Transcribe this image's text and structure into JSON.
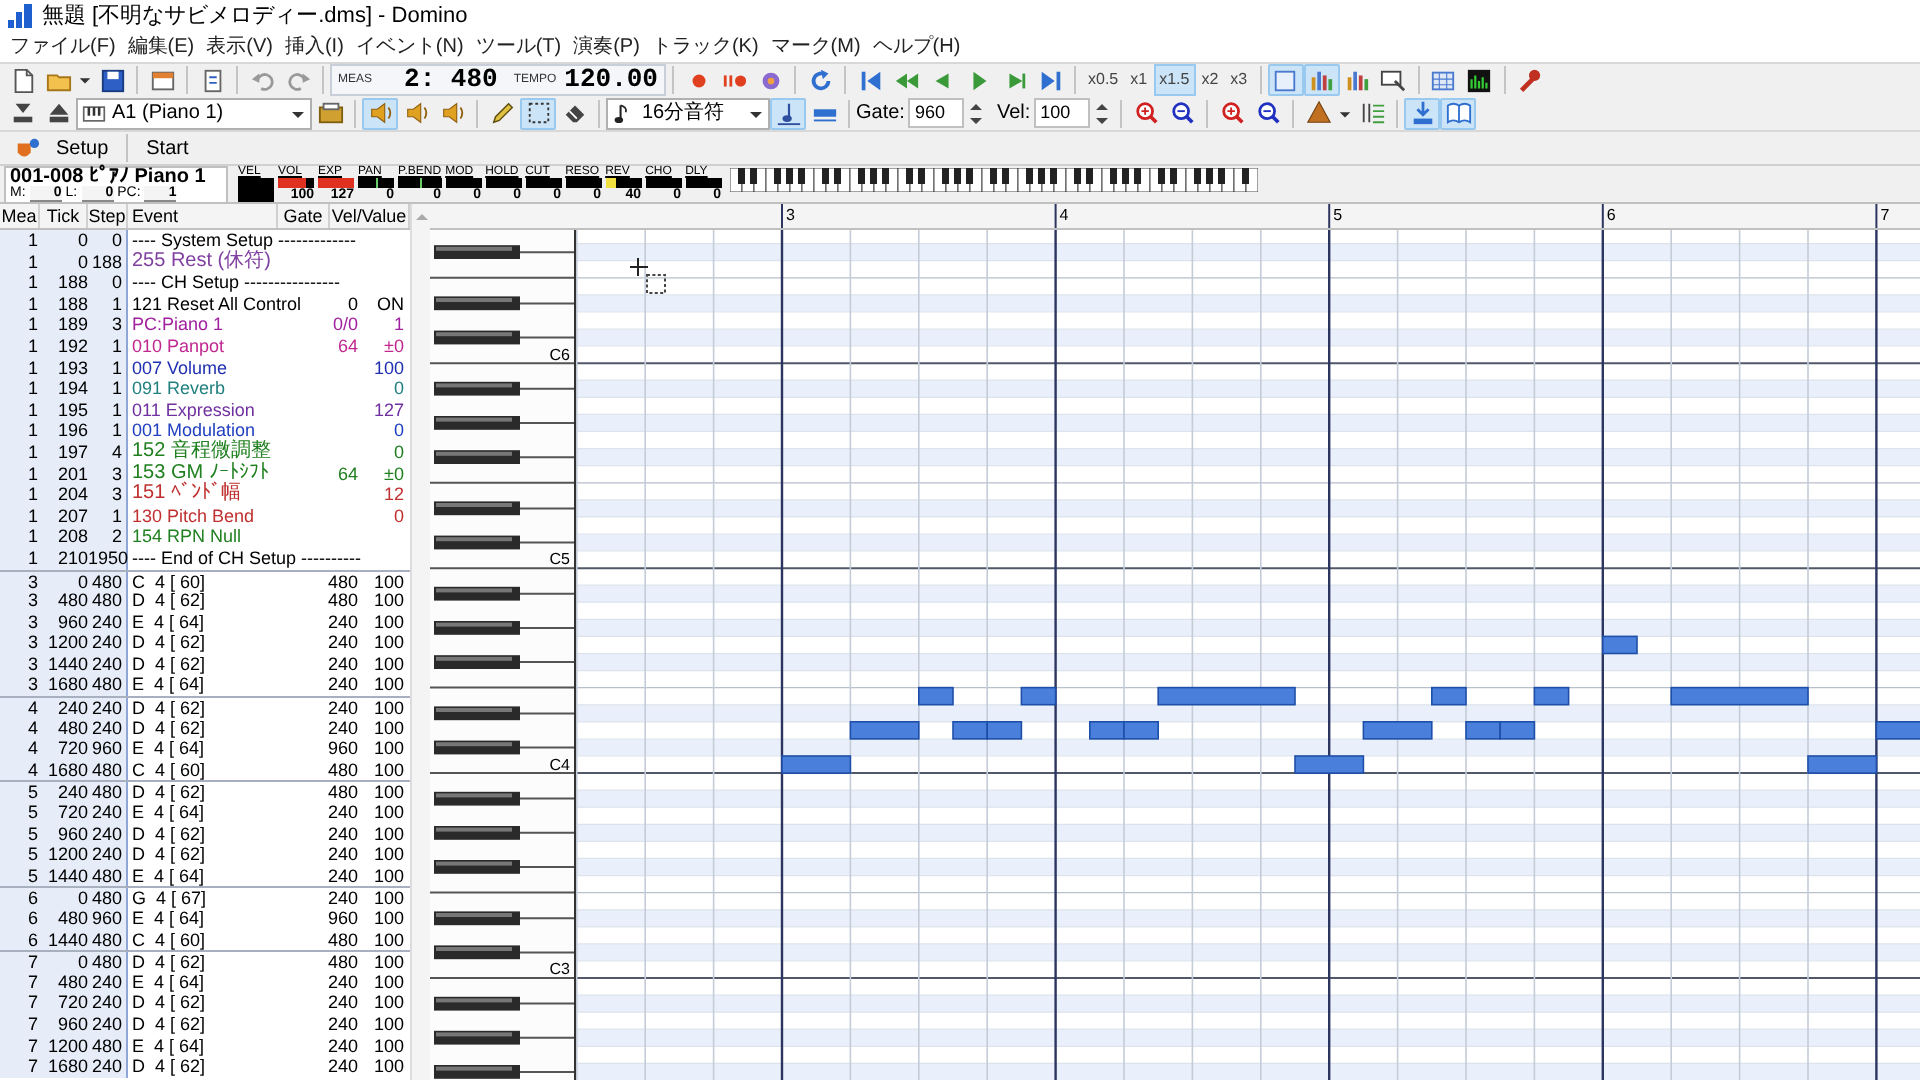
{
  "window": {
    "title": "無題 [不明なサビメロディー.dms] - Domino"
  },
  "menu": [
    "ファイル(F)",
    "編集(E)",
    "表示(V)",
    "挿入(I)",
    "イベント(N)",
    "ツール(T)",
    "演奏(P)",
    "トラック(K)",
    "マーク(M)",
    "ヘルプ(H)"
  ],
  "toolbar_1": {
    "meas_label": "MEAS",
    "position": "2: 480",
    "tempo_label": "TEMPO",
    "tempo": "120.00",
    "speeds": [
      {
        "label": "x0.5",
        "selected": false
      },
      {
        "label": "x1",
        "selected": false
      },
      {
        "label": "x1.5",
        "selected": true
      },
      {
        "label": "x2",
        "selected": false
      },
      {
        "label": "x3",
        "selected": false
      }
    ],
    "view_toggles": [
      {
        "selected": true
      },
      {
        "selected": true
      },
      {
        "selected": false
      },
      {
        "selected": false
      }
    ]
  },
  "toolbar_2": {
    "track": "A1 (Piano 1)",
    "mute_toggles": [
      {
        "selected": true
      },
      {
        "selected": false
      },
      {
        "selected": false
      }
    ],
    "tool_toggles": [
      {
        "selected": false
      },
      {
        "selected": true
      },
      {
        "selected": false
      }
    ],
    "note_length": "16分音符",
    "snap_toggles": [
      {
        "selected": true
      },
      {
        "selected": false
      }
    ],
    "gate_label": "Gate:",
    "gate": "960",
    "vel_label": "Vel:",
    "vel": "100",
    "panel_toggles": [
      {
        "selected": true
      },
      {
        "selected": true
      }
    ]
  },
  "toolbar_3": {
    "buttons": [
      "Setup",
      "Start"
    ]
  },
  "track_info": {
    "name": "001-008 ﾋﾟｱﾉ Piano 1",
    "fields": [
      {
        "label": "M:",
        "value": "0"
      },
      {
        "label": "L:",
        "value": "0"
      },
      {
        "label": "PC:",
        "value": "1"
      }
    ]
  },
  "meters": [
    {
      "label": "VEL",
      "kind": "block"
    },
    {
      "label": "VOL",
      "kind": "bar",
      "value": "100",
      "level": 0.79,
      "color": "#e03020"
    },
    {
      "label": "EXP",
      "kind": "bar",
      "value": "127",
      "level": 1,
      "color": "#e03020"
    },
    {
      "label": "PAN",
      "kind": "center",
      "value": "0"
    },
    {
      "label": "P.BEND",
      "kind": "center",
      "value": "0"
    },
    {
      "label": "MOD",
      "kind": "bar",
      "value": "0"
    },
    {
      "label": "HOLD",
      "kind": "bar",
      "value": "0"
    },
    {
      "label": "CUT",
      "kind": "bar",
      "value": "0"
    },
    {
      "label": "RESO",
      "kind": "bar",
      "value": "0"
    },
    {
      "label": "REV",
      "kind": "bar",
      "value": "40",
      "level": 0.31,
      "color": "#f0e040"
    },
    {
      "label": "CHO",
      "kind": "bar",
      "value": "0"
    },
    {
      "label": "DLY",
      "kind": "bar",
      "value": "0"
    }
  ],
  "event_list": {
    "columns": [
      "Mea",
      "Tick",
      "Step",
      "Event",
      "Gate",
      "Vel/Value"
    ],
    "rows": [
      {
        "kind": "header",
        "mea": "1",
        "tick": "0",
        "step": "0",
        "event": "---- System Setup -------------",
        "color": "#000000",
        "measure_start": false
      },
      {
        "kind": "control",
        "mea": "1",
        "tick": "0",
        "step": "188",
        "event": "255 Rest (休符)",
        "color": "#8040a0",
        "measure_start": false
      },
      {
        "kind": "header",
        "mea": "1",
        "tick": "188",
        "step": "0",
        "event": "---- CH Setup ----------------",
        "color": "#000000",
        "measure_start": false
      },
      {
        "kind": "control",
        "mea": "1",
        "tick": "188",
        "step": "1",
        "event": "121 Reset All Control",
        "gate": "0",
        "value": "ON",
        "color": "#000000",
        "measure_start": false
      },
      {
        "kind": "control",
        "mea": "1",
        "tick": "189",
        "step": "3",
        "event": "PC:Piano 1",
        "gate": "0/0",
        "value": "1",
        "color": "#a020a0",
        "measure_start": false
      },
      {
        "kind": "control",
        "mea": "1",
        "tick": "192",
        "step": "1",
        "event": "010 Panpot",
        "gate": "64",
        "value": "±0",
        "color": "#c02890",
        "measure_start": false
      },
      {
        "kind": "control",
        "mea": "1",
        "tick": "193",
        "step": "1",
        "event": "007 Volume",
        "value": "100",
        "color": "#2030b0",
        "measure_start": false
      },
      {
        "kind": "control",
        "mea": "1",
        "tick": "194",
        "step": "1",
        "event": "091 Reverb",
        "value": "0",
        "color": "#208080",
        "measure_start": false
      },
      {
        "kind": "control",
        "mea": "1",
        "tick": "195",
        "step": "1",
        "event": "011 Expression",
        "value": "127",
        "color": "#7030a0",
        "measure_start": false
      },
      {
        "kind": "control",
        "mea": "1",
        "tick": "196",
        "step": "1",
        "event": "001 Modulation",
        "value": "0",
        "color": "#2040c0",
        "measure_start": false
      },
      {
        "kind": "control",
        "mea": "1",
        "tick": "197",
        "step": "4",
        "event": "152 音程微調整",
        "value": "0",
        "color": "#208020",
        "measure_start": false
      },
      {
        "kind": "control",
        "mea": "1",
        "tick": "201",
        "step": "3",
        "event": "153 GM ﾉｰﾄｼﾌﾄ",
        "gate": "64",
        "value": "±0",
        "color": "#208020",
        "measure_start": false
      },
      {
        "kind": "control",
        "mea": "1",
        "tick": "204",
        "step": "3",
        "event": "151 ﾍﾞﾝﾄﾞ幅",
        "value": "12",
        "color": "#c03030",
        "measure_start": false
      },
      {
        "kind": "control",
        "mea": "1",
        "tick": "207",
        "step": "1",
        "event": "130 Pitch Bend",
        "value": "0",
        "color": "#c03030",
        "measure_start": false
      },
      {
        "kind": "control",
        "mea": "1",
        "tick": "208",
        "step": "2",
        "event": "154 RPN Null",
        "color": "#208020",
        "measure_start": false
      },
      {
        "kind": "header",
        "mea": "1",
        "tick": "210",
        "step": "1950",
        "event": "---- End of CH Setup ----------",
        "color": "#000000",
        "measure_start": false
      },
      {
        "kind": "note",
        "mea": "3",
        "tick": "0",
        "step": "480",
        "event": "C  4 [ 60]",
        "gate": "480",
        "value": "100",
        "color": "#000000",
        "measure_start": true
      },
      {
        "kind": "note",
        "mea": "3",
        "tick": "480",
        "step": "480",
        "event": "D  4 [ 62]",
        "gate": "480",
        "value": "100",
        "color": "#000000",
        "measure_start": false
      },
      {
        "kind": "note",
        "mea": "3",
        "tick": "960",
        "step": "240",
        "event": "E  4 [ 64]",
        "gate": "240",
        "value": "100",
        "color": "#000000",
        "measure_start": false
      },
      {
        "kind": "note",
        "mea": "3",
        "tick": "1200",
        "step": "240",
        "event": "D  4 [ 62]",
        "gate": "240",
        "value": "100",
        "color": "#000000",
        "measure_start": false
      },
      {
        "kind": "note",
        "mea": "3",
        "tick": "1440",
        "step": "240",
        "event": "D  4 [ 62]",
        "gate": "240",
        "value": "100",
        "color": "#000000",
        "measure_start": false
      },
      {
        "kind": "note",
        "mea": "3",
        "tick": "1680",
        "step": "480",
        "event": "E  4 [ 64]",
        "gate": "240",
        "value": "100",
        "color": "#000000",
        "measure_start": false
      },
      {
        "kind": "note",
        "mea": "4",
        "tick": "240",
        "step": "240",
        "event": "D  4 [ 62]",
        "gate": "240",
        "value": "100",
        "color": "#000000",
        "measure_start": true
      },
      {
        "kind": "note",
        "mea": "4",
        "tick": "480",
        "step": "240",
        "event": "D  4 [ 62]",
        "gate": "240",
        "value": "100",
        "color": "#000000",
        "measure_start": false
      },
      {
        "kind": "note",
        "mea": "4",
        "tick": "720",
        "step": "960",
        "event": "E  4 [ 64]",
        "gate": "960",
        "value": "100",
        "color": "#000000",
        "measure_start": false
      },
      {
        "kind": "note",
        "mea": "4",
        "tick": "1680",
        "step": "480",
        "event": "C  4 [ 60]",
        "gate": "480",
        "value": "100",
        "color": "#000000",
        "measure_start": false
      },
      {
        "kind": "note",
        "mea": "5",
        "tick": "240",
        "step": "480",
        "event": "D  4 [ 62]",
        "gate": "480",
        "value": "100",
        "color": "#000000",
        "measure_start": true
      },
      {
        "kind": "note",
        "mea": "5",
        "tick": "720",
        "step": "240",
        "event": "E  4 [ 64]",
        "gate": "240",
        "value": "100",
        "color": "#000000",
        "measure_start": false
      },
      {
        "kind": "note",
        "mea": "5",
        "tick": "960",
        "step": "240",
        "event": "D  4 [ 62]",
        "gate": "240",
        "value": "100",
        "color": "#000000",
        "measure_start": false
      },
      {
        "kind": "note",
        "mea": "5",
        "tick": "1200",
        "step": "240",
        "event": "D  4 [ 62]",
        "gate": "240",
        "value": "100",
        "color": "#000000",
        "measure_start": false
      },
      {
        "kind": "note",
        "mea": "5",
        "tick": "1440",
        "step": "480",
        "event": "E  4 [ 64]",
        "gate": "240",
        "value": "100",
        "color": "#000000",
        "measure_start": false
      },
      {
        "kind": "note",
        "mea": "6",
        "tick": "0",
        "step": "480",
        "event": "G  4 [ 67]",
        "gate": "240",
        "value": "100",
        "color": "#000000",
        "measure_start": true
      },
      {
        "kind": "note",
        "mea": "6",
        "tick": "480",
        "step": "960",
        "event": "E  4 [ 64]",
        "gate": "960",
        "value": "100",
        "color": "#000000",
        "measure_start": false
      },
      {
        "kind": "note",
        "mea": "6",
        "tick": "1440",
        "step": "480",
        "event": "C  4 [ 60]",
        "gate": "480",
        "value": "100",
        "color": "#000000",
        "measure_start": false
      },
      {
        "kind": "note",
        "mea": "7",
        "tick": "0",
        "step": "480",
        "event": "D  4 [ 62]",
        "gate": "480",
        "value": "100",
        "color": "#000000",
        "measure_start": true
      },
      {
        "kind": "note",
        "mea": "7",
        "tick": "480",
        "step": "240",
        "event": "E  4 [ 64]",
        "gate": "240",
        "value": "100",
        "color": "#000000",
        "measure_start": false
      },
      {
        "kind": "note",
        "mea": "7",
        "tick": "720",
        "step": "240",
        "event": "D  4 [ 62]",
        "gate": "240",
        "value": "100",
        "color": "#000000",
        "measure_start": false
      },
      {
        "kind": "note",
        "mea": "7",
        "tick": "960",
        "step": "240",
        "event": "D  4 [ 62]",
        "gate": "240",
        "value": "100",
        "color": "#000000",
        "measure_start": false
      },
      {
        "kind": "note",
        "mea": "7",
        "tick": "1200",
        "step": "480",
        "event": "E  4 [ 64]",
        "gate": "240",
        "value": "100",
        "color": "#000000",
        "measure_start": false
      },
      {
        "kind": "note",
        "mea": "7",
        "tick": "1680",
        "step": "240",
        "event": "D  4 [ 62]",
        "gate": "240",
        "value": "100",
        "color": "#000000",
        "measure_start": false
      }
    ]
  },
  "piano_roll": {
    "ruler": [
      "3",
      "4",
      "5",
      "6",
      "7"
    ],
    "key_labels": [
      "C6",
      "C5",
      "C4",
      "C3"
    ]
  }
}
